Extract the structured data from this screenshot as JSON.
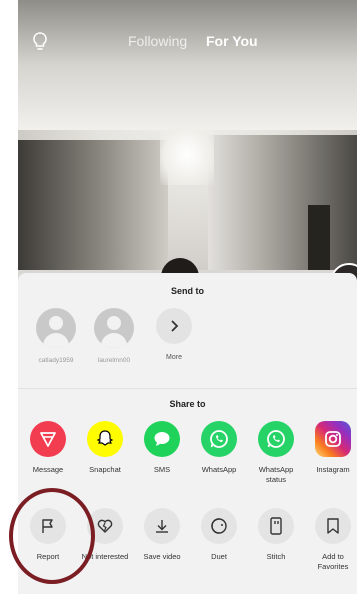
{
  "topbar": {
    "following": "Following",
    "for_you": "For You",
    "icon": "lightbulb-icon"
  },
  "send_to": {
    "title": "Send to",
    "contacts": [
      {
        "name": "catlady1959"
      },
      {
        "name": "laurelmn00"
      }
    ],
    "more": "More"
  },
  "share_to": {
    "title": "Share to",
    "apps": [
      {
        "label": "Message",
        "color": "#f23c50",
        "icon": "message-icon"
      },
      {
        "label": "Snapchat",
        "color": "#fffc00",
        "icon": "snapchat-icon"
      },
      {
        "label": "SMS",
        "color": "#1fd25a",
        "icon": "sms-icon"
      },
      {
        "label": "WhatsApp",
        "color": "#25d366",
        "icon": "whatsapp-icon"
      },
      {
        "label": "WhatsApp status",
        "color": "#25d366",
        "icon": "whatsapp-icon"
      },
      {
        "label": "Instagram",
        "color": "#d6249f",
        "icon": "instagram-icon"
      }
    ]
  },
  "actions": [
    {
      "label": "Report",
      "icon": "flag-icon"
    },
    {
      "label": "Not interested",
      "icon": "broken-heart-icon"
    },
    {
      "label": "Save video",
      "icon": "download-icon"
    },
    {
      "label": "Duet",
      "icon": "duet-icon"
    },
    {
      "label": "Stitch",
      "icon": "stitch-icon"
    },
    {
      "label": "Add to Favorites",
      "icon": "bookmark-icon"
    }
  ],
  "colors": {
    "highlight_ring": "#7a1e24"
  }
}
